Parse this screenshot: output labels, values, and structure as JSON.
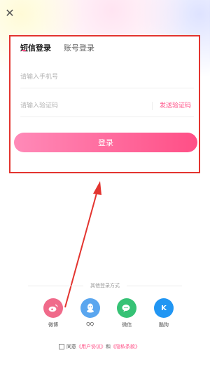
{
  "tabs": {
    "sms": "短信登录",
    "account": "账号登录"
  },
  "phone_field": {
    "placeholder": "请输入手机号"
  },
  "code_field": {
    "placeholder": "请输入验证码"
  },
  "send_code": "发送验证码",
  "login_button": "登录",
  "other_login": "其他登录方式",
  "socials": [
    {
      "name": "微博",
      "icon": "weibo-icon",
      "color": "#f06a8a"
    },
    {
      "name": "QQ",
      "icon": "qq-icon",
      "color": "#5aa6ef"
    },
    {
      "name": "微信",
      "icon": "wechat-icon",
      "color": "#36c275"
    },
    {
      "name": "酷狗",
      "icon": "kugou-icon",
      "color": "#2196f3",
      "glyph": "K"
    }
  ],
  "agreement": {
    "agree": "同意",
    "user_agreement": "《用户协议》",
    "and": "和",
    "privacy_policy": "《隐私条款》"
  },
  "colors": {
    "accent": "#ff4f86",
    "highlight_border": "#e3342f"
  }
}
